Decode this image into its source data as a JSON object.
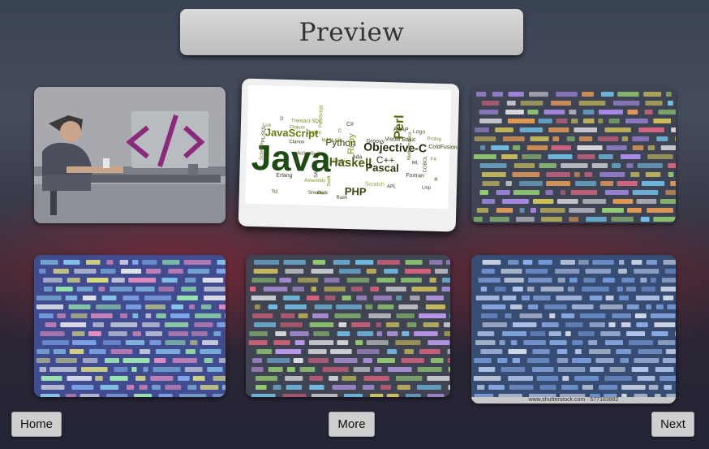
{
  "header": {
    "title": "Preview"
  },
  "tiles": [
    {
      "name": "developer-illustration"
    },
    {
      "name": "language-word-cloud",
      "words": [
        "Java",
        "JavaScript",
        "Python",
        "Haskell",
        "PHP",
        "Pascal",
        "Ruby",
        "Perl",
        "Objective-C",
        "C++",
        "C#",
        "C",
        "ABAP",
        "Visual Basic",
        "Logo",
        "Prolog",
        "ColdFusion",
        "Fortran",
        "Ada",
        "Lua",
        "PL/SQL",
        "Delphi",
        "Scheme",
        "Erlang",
        "Assembly",
        "Scratch",
        "COBOL",
        "Darbi",
        "SAS",
        "Swift",
        "MATLAB",
        "Groovy",
        "Mathematica",
        "Clarion",
        "Transact-SQL",
        "PostScript",
        "ML",
        "F#",
        "R",
        "ActionScript",
        "Tcl",
        "Lisp",
        "Go",
        "Bash",
        "APL",
        "Clojure",
        "Smalltalk",
        "D"
      ]
    },
    {
      "name": "code-screen-colorful"
    },
    {
      "name": "code-screen-blue"
    },
    {
      "name": "code-screen-dark"
    },
    {
      "name": "code-screen-stock",
      "watermark": "www.shutterstock.com · 577183882"
    }
  ],
  "buttons": {
    "home": "Home",
    "more": "More",
    "next": "Next"
  },
  "colors": {
    "button_bg": "#cfcfcf",
    "title_bg": "#d0d0d0",
    "accent_purple": "#8a2a7a",
    "java_green": "#1f4a14"
  }
}
